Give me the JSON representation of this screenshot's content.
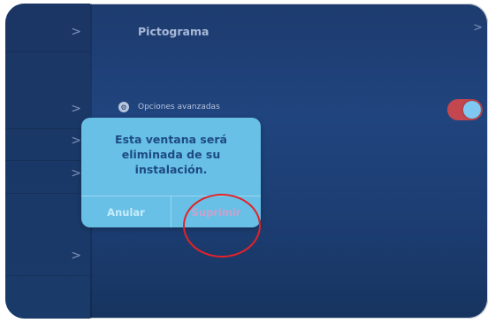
{
  "header": {
    "title": "Pictograma"
  },
  "settings": {
    "advanced": {
      "label": "Opciones avanzadas",
      "icon": "gear-icon",
      "toggle_on": true
    }
  },
  "dialog": {
    "message_lines": [
      "Esta ventana será",
      "eliminada de su",
      "instalación."
    ],
    "cancel_label": "Anular",
    "delete_label": "Suprimir"
  },
  "colors": {
    "background": "#1d3b6e",
    "dialog": "#68c0e6",
    "toggle_track": "#c4474f",
    "toggle_knob": "#7ec8f1",
    "highlight_circle": "#e32227"
  }
}
